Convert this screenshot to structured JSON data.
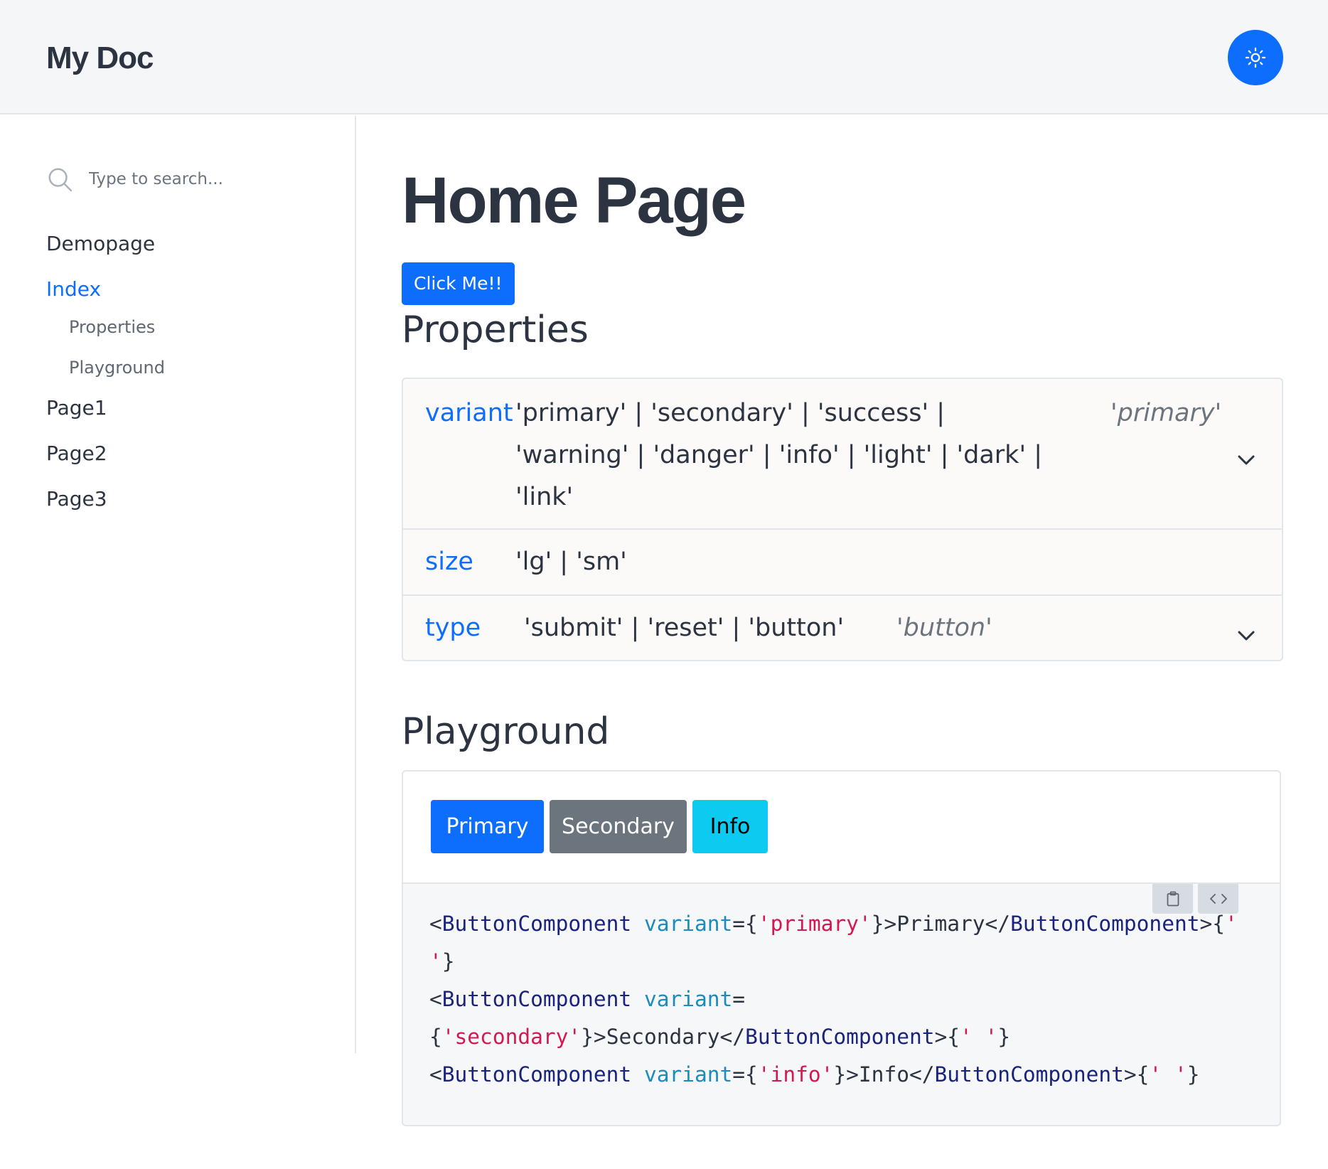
{
  "header": {
    "title": "My Doc",
    "theme_icon": "sun-icon"
  },
  "sidebar": {
    "search_placeholder": "Type to search...",
    "items": [
      {
        "label": "Demopage",
        "active": false
      },
      {
        "label": "Index",
        "active": true,
        "children": [
          {
            "label": "Properties"
          },
          {
            "label": "Playground"
          }
        ]
      },
      {
        "label": "Page1",
        "active": false
      },
      {
        "label": "Page2",
        "active": false
      },
      {
        "label": "Page3",
        "active": false
      }
    ]
  },
  "main": {
    "title": "Home Page",
    "click_button": "Click Me!!",
    "properties_heading": "Properties",
    "properties": [
      {
        "name": "variant",
        "type_line1": "'primary' | 'secondary' | 'success' |",
        "type_line2": "'warning' | 'danger' | 'info' | 'light' | 'dark' |",
        "type_line3": "'link'",
        "default": "'primary'"
      },
      {
        "name": "size",
        "type": "'lg' | 'sm'",
        "default": ""
      },
      {
        "name": "type",
        "type": "'submit' | 'reset' | 'button'",
        "default": "'button'"
      }
    ],
    "playground_heading": "Playground",
    "playground": {
      "buttons": [
        {
          "label": "Primary",
          "color": "#0d6efd"
        },
        {
          "label": "Secondary",
          "color": "#6c757d"
        },
        {
          "label": "Info",
          "color": "#0dcaf0"
        }
      ],
      "toolbar_icons": [
        "clipboard-icon",
        "code-icon"
      ],
      "code": {
        "tag": "ButtonComponent",
        "attr": "variant",
        "values": [
          "primary",
          "secondary",
          "info"
        ],
        "children": [
          "Primary",
          "Secondary",
          "Info"
        ],
        "space_literal": "' '"
      }
    }
  }
}
